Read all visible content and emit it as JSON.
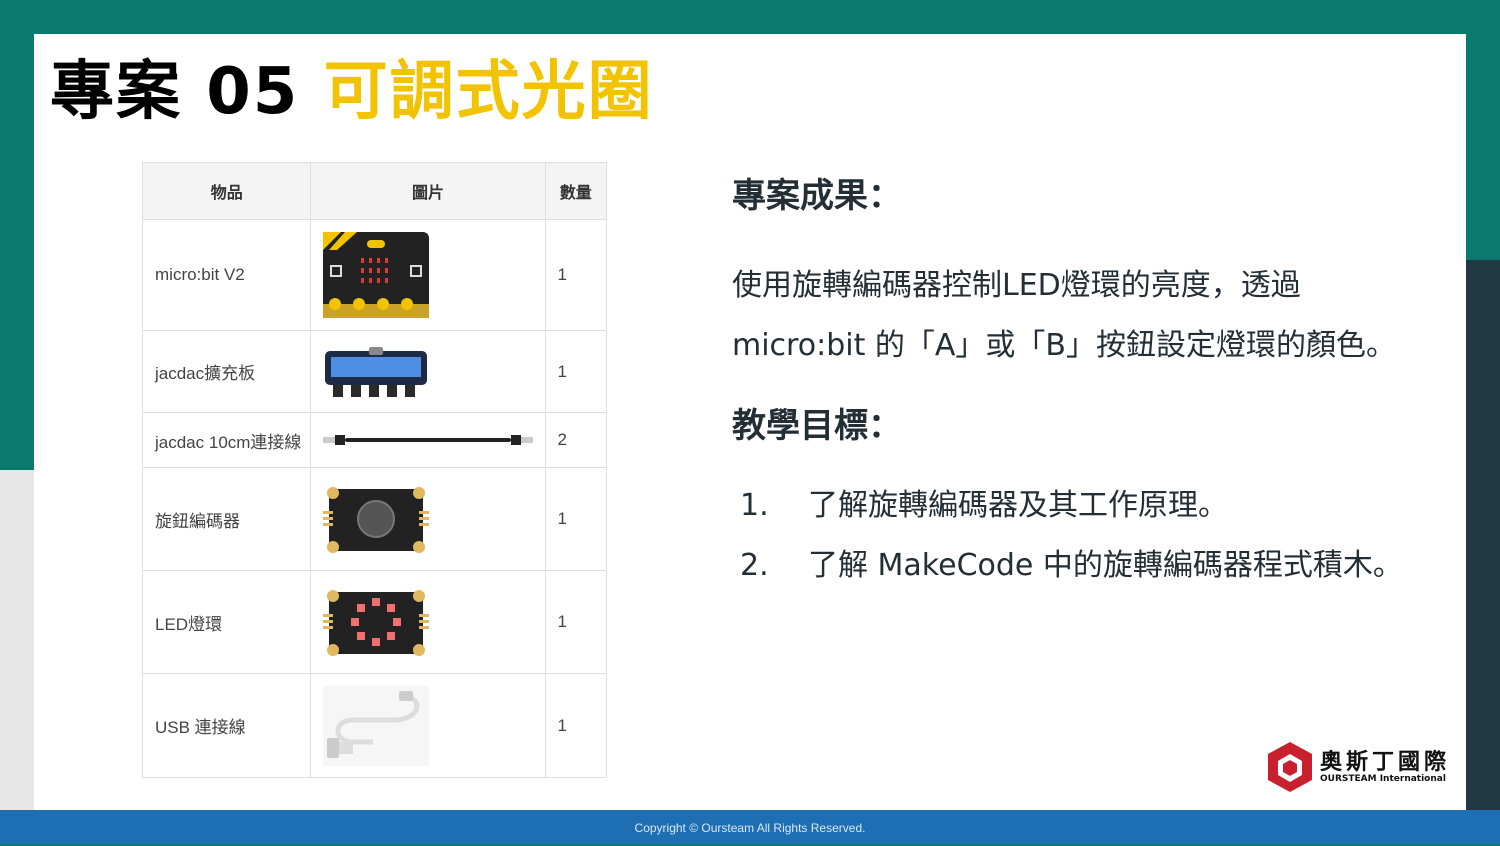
{
  "title": {
    "prefix": "專案 05 ",
    "highlight": "可調式光圈"
  },
  "table": {
    "headers": [
      "物品",
      "圖片",
      "數量"
    ],
    "rows": [
      {
        "item": "micro:bit V2",
        "image": "microbit-board-image",
        "qty": "1"
      },
      {
        "item": "jacdac擴充板",
        "image": "jacdac-expansion-board-image",
        "qty": "1"
      },
      {
        "item": "jacdac 10cm連接線",
        "image": "jacdac-cable-image",
        "qty": "2"
      },
      {
        "item": "旋鈕編碼器",
        "image": "rotary-encoder-image",
        "qty": "1"
      },
      {
        "item": "LED燈環",
        "image": "led-ring-image",
        "qty": "1"
      },
      {
        "item": "USB 連接線",
        "image": "usb-cable-image",
        "qty": "1"
      }
    ]
  },
  "result": {
    "heading": "專案成果：",
    "line1": "使用旋轉編碼器控制LED燈環的亮度，透過",
    "line2": "micro:bit 的「A」或「B」按鈕設定燈環的顏色。"
  },
  "goals": {
    "heading": "教學目標：",
    "items": [
      {
        "num": "1.",
        "text": "了解旋轉編碼器及其工作原理。"
      },
      {
        "num": "2.",
        "text": "了解 MakeCode 中的旋轉編碼器程式積木。"
      }
    ]
  },
  "logo": {
    "name": "奧斯丁國際",
    "sub": "OURSTEAM International"
  },
  "footer": {
    "copyright": "Copyright © Oursteam All Rights Reserved."
  },
  "colors": {
    "teal": "#0a7a6e",
    "highlight": "#f2c300",
    "footer": "#1e6eb4",
    "logo_red": "#c8202f"
  }
}
